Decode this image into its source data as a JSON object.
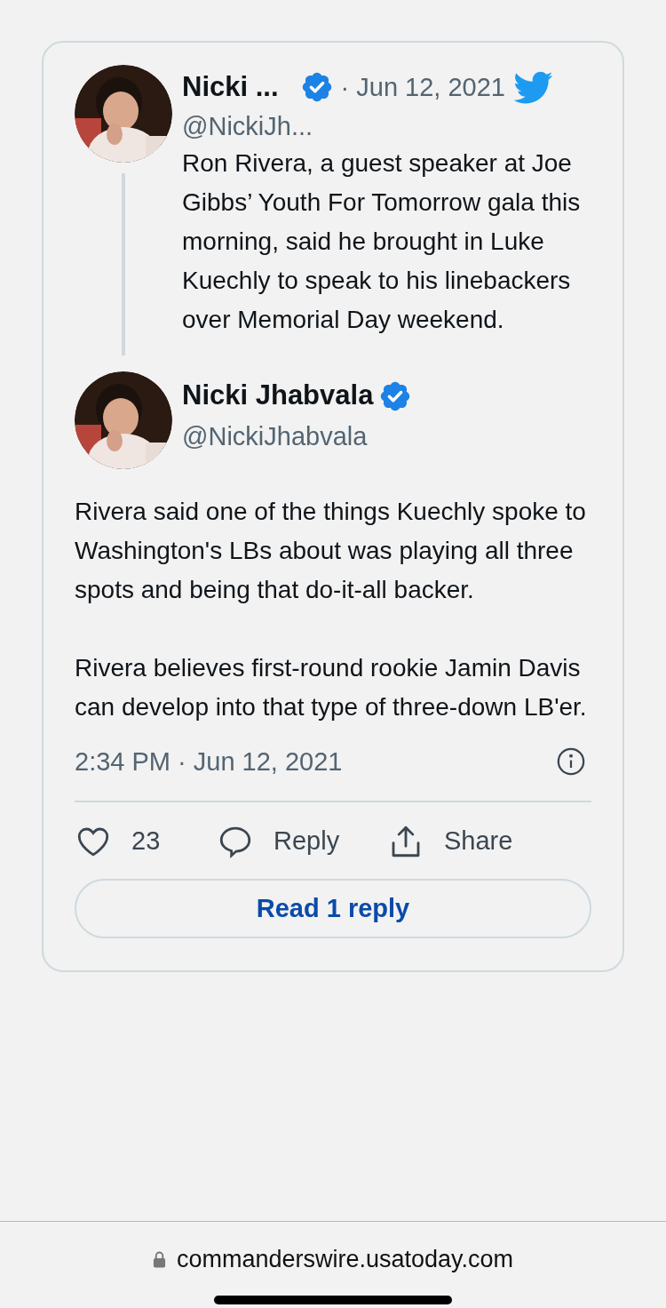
{
  "parent_tweet": {
    "name": "Nicki ...",
    "verified": true,
    "date": "· Jun 12, 2021",
    "handle": "@NickiJh...",
    "text": "Ron Rivera, a guest speaker at Joe Gibbs’ Youth For Tomorrow gala this morning, said he brought in Luke Kuechly to speak to his linebackers over Memorial Day weekend."
  },
  "main_tweet": {
    "name": "Nicki Jhabvala",
    "verified": true,
    "handle": "@NickiJhabvala",
    "paragraphs": [
      "Rivera said one of the things Kuechly spoke to Washington's LBs about was playing all three spots and being that do-it-all backer.",
      "Rivera believes first-round rookie Jamin Davis can develop into that type of three-down LB'er."
    ],
    "timestamp": "2:34 PM · Jun 12, 2021",
    "likes": "23",
    "reply_label": "Reply",
    "share_label": "Share",
    "read_replies": "Read 1 reply"
  },
  "browser": {
    "url": "commanderswire.usatoday.com"
  }
}
